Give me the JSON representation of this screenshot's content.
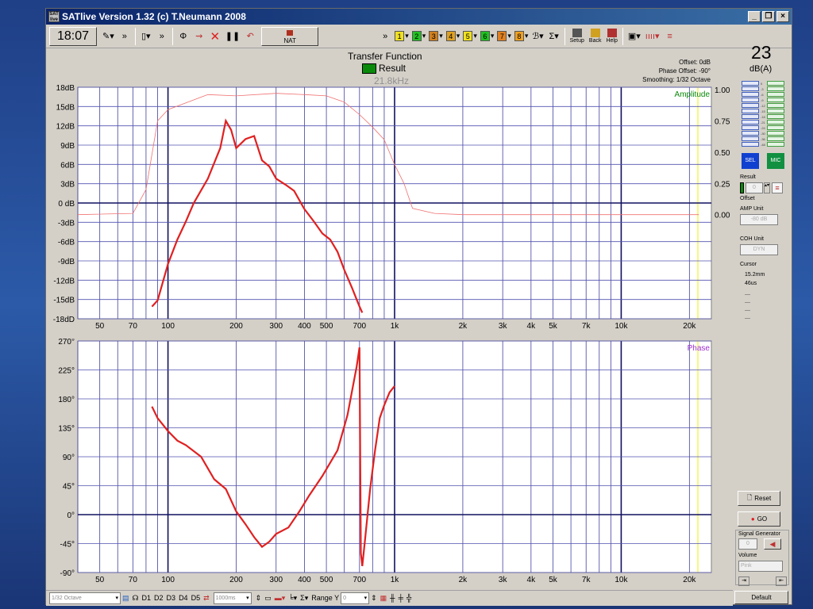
{
  "window": {
    "title": "SATlive Version 1.32 (c) T.Neumann 2008",
    "app_icon_text": "SAT live",
    "buttons": {
      "minimize": "_",
      "restore": "❐",
      "close": "×"
    }
  },
  "toolbar": {
    "time": "18:07",
    "nat_label": "NAT",
    "chips": [
      {
        "label": "1",
        "color": "#f0e020"
      },
      {
        "label": "2",
        "color": "#20c020"
      },
      {
        "label": "3",
        "color": "#d08020"
      },
      {
        "label": "4",
        "color": "#e0a020"
      },
      {
        "label": "5",
        "color": "#f0e020"
      },
      {
        "label": "6",
        "color": "#20c020"
      },
      {
        "label": "7",
        "color": "#e08020"
      },
      {
        "label": "8",
        "color": "#f0a020"
      }
    ],
    "sigma": "Σ",
    "setup_label": "Setup",
    "back_label": "Back",
    "help_label": "Help"
  },
  "plot_header": {
    "title": "Transfer Function",
    "legend": "Result",
    "legend_color": "#0a8a0a",
    "cursor_freq": "21.8kHz",
    "offset": "Offset: 0dB",
    "phase_offset": "Phase Offset: -90°",
    "smoothing": "Smoothing: 1/32 Octave"
  },
  "amplitude_plot": {
    "label": "Amplitude",
    "y_ticks": [
      "18dB",
      "15dB",
      "12dB",
      "9dB",
      "6dB",
      "3dB",
      "0 dB",
      "-3dB",
      "-6dB",
      "-9dB",
      "-12dB",
      "-15dB",
      "-18dD"
    ],
    "coherence_ticks": [
      "1.00",
      "0.75",
      "0.50",
      "0.25",
      "0.00"
    ],
    "x_ticks": [
      "50",
      "70",
      "100",
      "200",
      "300",
      "400",
      "500",
      "700",
      "1k",
      "2k",
      "3k",
      "4k",
      "5k",
      "7k",
      "10k",
      "20k"
    ]
  },
  "phase_plot": {
    "label": "Phase",
    "y_ticks": [
      "270°",
      "225°",
      "180°",
      "135°",
      "90°",
      "45°",
      "0°",
      "-45°",
      "-90°"
    ],
    "x_ticks": [
      "50",
      "70",
      "100",
      "200",
      "300",
      "400",
      "500",
      "700",
      "1k",
      "2k",
      "3k",
      "4k",
      "5k",
      "7k",
      "10k",
      "20k"
    ]
  },
  "chart_data": [
    {
      "type": "line",
      "title": "Transfer Function",
      "series": [
        {
          "name": "Result",
          "color": "#e02020",
          "x": [
            85,
            90,
            100,
            110,
            120,
            130,
            150,
            170,
            180,
            190,
            200,
            220,
            240,
            260,
            280,
            300,
            330,
            360,
            400,
            440,
            480,
            520,
            560,
            600,
            650,
            700,
            720
          ],
          "values": [
            -17,
            -16,
            -10,
            -6,
            -3,
            0,
            4,
            9,
            13.5,
            12,
            9,
            10.5,
            11,
            7,
            6,
            4,
            3,
            2,
            -1,
            -3,
            -5,
            -6,
            -8,
            -11,
            -14,
            -17,
            -18
          ]
        },
        {
          "name": "Coherence",
          "color": "#f07070",
          "x": [
            40,
            70,
            80,
            90,
            100,
            150,
            200,
            300,
            400,
            500,
            600,
            700,
            800,
            900,
            1000,
            1100,
            1200,
            1500,
            2000,
            5000,
            10000,
            22000
          ],
          "values": [
            0.0,
            0.01,
            0.2,
            0.75,
            0.84,
            0.96,
            0.95,
            0.97,
            0.96,
            0.95,
            0.9,
            0.8,
            0.7,
            0.6,
            0.4,
            0.25,
            0.05,
            0.01,
            0.0,
            0.0,
            0.0,
            0.0
          ]
        }
      ],
      "xlabel": "",
      "ylabel": "",
      "xscale": "log",
      "xlim": [
        40,
        25000
      ],
      "ylim": [
        -19,
        19
      ],
      "y2lim": [
        0,
        1
      ],
      "grid": true
    },
    {
      "type": "line",
      "title": "",
      "series": [
        {
          "name": "Result",
          "color": "#e02020",
          "x": [
            85,
            90,
            100,
            110,
            120,
            140,
            160,
            180,
            200,
            220,
            240,
            260,
            280,
            300,
            340,
            380,
            420,
            480,
            560,
            620,
            680,
            700,
            710,
            720,
            740,
            780,
            820,
            860,
            900,
            950,
            1000
          ],
          "values": [
            168,
            150,
            130,
            115,
            108,
            90,
            55,
            40,
            5,
            -15,
            -35,
            -50,
            -42,
            -30,
            -20,
            5,
            30,
            60,
            100,
            155,
            230,
            260,
            -60,
            -80,
            -40,
            40,
            100,
            150,
            170,
            190,
            200
          ]
        }
      ],
      "xlabel": "",
      "ylabel": "",
      "xscale": "log",
      "xlim": [
        40,
        25000
      ],
      "ylim": [
        -90,
        270
      ],
      "grid": true
    }
  ],
  "right_panel": {
    "spl_value": "23",
    "spl_unit": "dB(A)",
    "meter_scale": [
      "0",
      "-3",
      "-6",
      "-9",
      "-12",
      "-15",
      "-18",
      "-21",
      "-24",
      "-30",
      "-36",
      "-48"
    ],
    "sel_label": "SEL",
    "mic_label": "MIC",
    "result_label": "Result",
    "result_value": "0",
    "offset_label": "Offset",
    "amp_unit_label": "AMP Unit",
    "amp_unit_value": "-80 dB",
    "coh_unit_label": "COH Unit",
    "coh_unit_value": "DYN",
    "cursor_label": "Cursor",
    "cursor_dist": "15.2mm",
    "cursor_time": "46us",
    "reset_label": "Reset",
    "go_label": "GO",
    "sig_gen_label": "Signal Generator",
    "sig_gen_value": "0",
    "volume_label": "Volume",
    "volume_value": "Pink",
    "default_label": "Default"
  },
  "statusbar": {
    "smoothing_select": "1/32 Octave",
    "d_labels": [
      "D1",
      "D2",
      "D3",
      "D4",
      "D5"
    ],
    "delay_value": "1000ms",
    "range_label": "Range Y",
    "range_value": "0"
  }
}
